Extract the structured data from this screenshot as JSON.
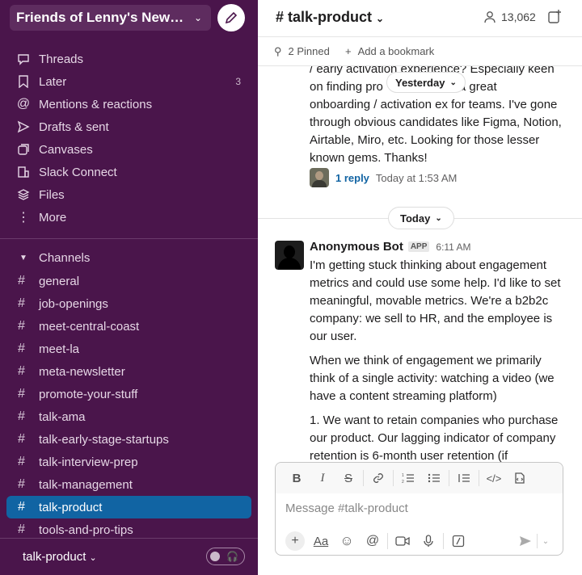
{
  "workspace": {
    "name": "Friends of Lenny's Newsletter"
  },
  "nav": [
    {
      "label": "Threads",
      "icon": "threads-icon"
    },
    {
      "label": "Later",
      "icon": "bookmark-icon",
      "badge": "3"
    },
    {
      "label": "Mentions & reactions",
      "icon": "at-icon"
    },
    {
      "label": "Drafts & sent",
      "icon": "send-icon"
    },
    {
      "label": "Canvases",
      "icon": "canvas-icon"
    },
    {
      "label": "Slack Connect",
      "icon": "building-icon"
    },
    {
      "label": "Files",
      "icon": "files-icon"
    },
    {
      "label": "More",
      "icon": "more-icon"
    }
  ],
  "channels_section": {
    "label": "Channels"
  },
  "channels": [
    "general",
    "job-openings",
    "meet-central-coast",
    "meet-la",
    "meta-newsletter",
    "promote-your-stuff",
    "talk-ama",
    "talk-early-stage-startups",
    "talk-interview-prep",
    "talk-management",
    "talk-product",
    "tools-and-pro-tips"
  ],
  "active_channel": "talk-product",
  "footer": {
    "channel": "talk-product"
  },
  "header": {
    "title": "# talk-product",
    "member_count": "13,062"
  },
  "bookmarks": {
    "pinned": "2 Pinned",
    "add": "Add a bookmark"
  },
  "messages": {
    "prev_text": "/ early activation experience? Especially keen on finding pro... ve a great onboarding / activation ex for teams.  I've gone through obvious candidates like Figma, Notion, Airtable, Miro, etc.  Looking for those lesser known gems.  Thanks!",
    "prev_line1": "/ early activation experience? Especially keen",
    "prev_line2": "on finding pro",
    "prev_line2b": "ve a great",
    "prev_line3": "onboarding / activation ex for teams.  I've gone",
    "prev_line4": "through obvious candidates like Figma, Notion,",
    "prev_line5": "Airtable, Miro, etc.  Looking for those lesser",
    "prev_line6": "known gems.  Thanks!",
    "reply_count": "1 reply",
    "reply_time": "Today at 1:53 AM",
    "divider_yesterday": "Yesterday",
    "divider_today": "Today",
    "sender": "Anonymous Bot",
    "app_badge": "APP",
    "time": "6:11 AM",
    "para1": "I'm getting stuck thinking about engagement metrics and could use some help. I'd like to set meaningful, movable metrics. We're a b2b2c company: we sell to HR, and the employee is our user.",
    "para2": "When we think of engagement we primarily think of a single activity: watching a video (we have a content streaming platform)",
    "para3": "1. We want to retain companies who purchase our product. Our lagging indicator of company retention is 6-month user retention (if"
  },
  "composer": {
    "placeholder": "Message #talk-product"
  },
  "colors": {
    "sidebar": "#4a154b",
    "active": "#1164a3",
    "link": "#1264a3"
  }
}
